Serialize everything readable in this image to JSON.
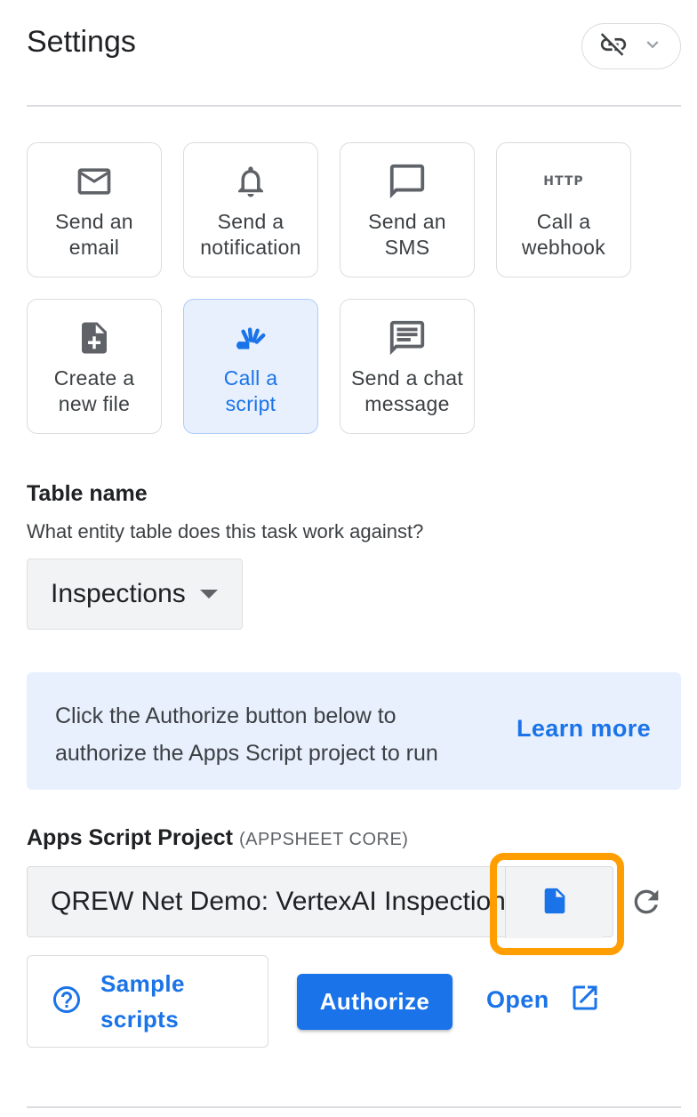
{
  "header": {
    "title": "Settings",
    "link_icon": "link-off-icon",
    "toggle_icon": "chevron-down-icon"
  },
  "tasks": [
    {
      "label": "Send an email",
      "lines": [
        "Send an",
        "email"
      ],
      "icon": "email-icon",
      "selected": false
    },
    {
      "label": "Send a notification",
      "lines": [
        "Send a",
        "notification"
      ],
      "icon": "bell-icon",
      "selected": false
    },
    {
      "label": "Send an SMS",
      "lines": [
        "Send an",
        "SMS"
      ],
      "icon": "sms-icon",
      "selected": false
    },
    {
      "label": "Call a webhook",
      "lines": [
        "Call a",
        "webhook"
      ],
      "icon": "http-icon",
      "icon_text": "HTTP",
      "selected": false
    },
    {
      "label": "Create a new file",
      "lines": [
        "Create a",
        "new file"
      ],
      "icon": "note-add-icon",
      "selected": false
    },
    {
      "label": "Call a script",
      "lines": [
        "Call a",
        "script"
      ],
      "icon": "apps-script-icon",
      "selected": true
    },
    {
      "label": "Send a chat message",
      "lines": [
        "Send a chat",
        "message"
      ],
      "icon": "chat-icon",
      "selected": false
    }
  ],
  "table": {
    "heading": "Table name",
    "description": "What entity table does this task work against?",
    "selected": "Inspections"
  },
  "banner": {
    "line1": "Click the Authorize button below to",
    "line2": "authorize the Apps Script project to run",
    "learn_more": "Learn more"
  },
  "project": {
    "heading": "Apps Script Project",
    "subheading": "(APPSHEET CORE)",
    "value": "QREW Net Demo: VertexAI Inspections",
    "file_icon": "file-icon",
    "refresh_icon": "refresh-icon"
  },
  "actions": {
    "sample_line1": "Sample",
    "sample_line2": "scripts",
    "sample_icon": "help-circle-icon",
    "authorize": "Authorize",
    "open": "Open",
    "open_icon": "open-in-new-icon"
  },
  "colors": {
    "accent": "#1a73e8",
    "highlight": "#ff9e00",
    "banner_bg": "#e8f0fe"
  }
}
